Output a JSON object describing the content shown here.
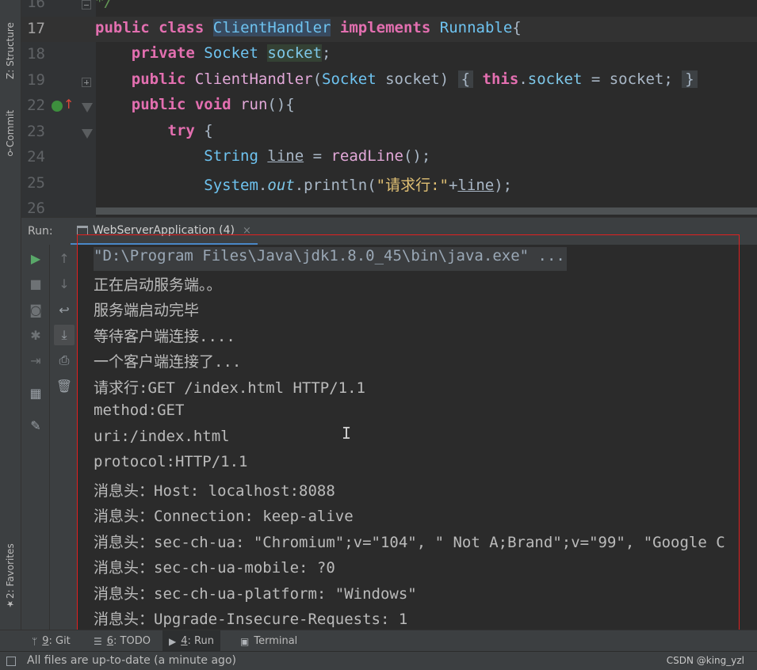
{
  "left_strip": {
    "structure_label": "Z: Structure",
    "commit_label": "Commit",
    "favorites_label": "2: Favorites"
  },
  "editor": {
    "lines": [
      {
        "num": "16",
        "tokens": [
          {
            "t": "*/",
            "c": "cm"
          }
        ],
        "indent": 0
      },
      {
        "num": "17",
        "current": true
      },
      {
        "num": "18"
      },
      {
        "num": "19"
      },
      {
        "num": "22"
      },
      {
        "num": "23"
      },
      {
        "num": "24"
      },
      {
        "num": "25"
      },
      {
        "num": "26"
      }
    ],
    "l17": {
      "kw1": "public",
      "kw2": "class",
      "cls": "ClientHandler",
      "kw3": "implements",
      "iface": "Runnable",
      "brace": "{"
    },
    "l18": {
      "kw": "private",
      "type": "Socket",
      "field": "socket",
      "semi": ";"
    },
    "l19": {
      "kw": "public",
      "ctor": "ClientHandler",
      "open": "(",
      "type": "Socket",
      "param": " socket)",
      "b1": "{",
      "this": "this",
      "dot": ".",
      "field": "socket",
      "rest": " = socket;",
      "b2": "}"
    },
    "l22": {
      "kw1": "public",
      "kw2": "void",
      "fn": "run",
      "rest": "(){"
    },
    "l23": {
      "kw": "try",
      "rest": " {"
    },
    "l24": {
      "type": "String",
      "var": "line",
      "eq": " = ",
      "fn": "readLine",
      "rest": "();"
    },
    "l25": {
      "cls": "System",
      "dot": ".",
      "out": "out",
      "call": ".println(",
      "str": "\"请求行:\"",
      "plus": "+",
      "var": "line",
      "rest": ");"
    }
  },
  "run_bar": {
    "label": "Run:",
    "tab_title": "WebServerApplication (4)",
    "tab_close": "×"
  },
  "console": {
    "lines": [
      "\"D:\\Program Files\\Java\\jdk1.8.0_45\\bin\\java.exe\" ...",
      "正在启动服务端。。",
      "服务端启动完毕",
      "等待客户端连接....",
      "一个客户端连接了...",
      "请求行:GET /index.html HTTP/1.1",
      "method:GET",
      "uri:/index.html",
      "protocol:HTTP/1.1",
      "消息头：Host: localhost:8088",
      "消息头：Connection: keep-alive",
      "消息头：sec-ch-ua: \"Chromium\";v=\"104\", \" Not A;Brand\";v=\"99\", \"Google C",
      "消息头：sec-ch-ua-mobile: ?0",
      "消息头：sec-ch-ua-platform: \"Windows\"",
      "消息头：Upgrade-Insecure-Requests: 1"
    ],
    "caret": "I"
  },
  "bottom_bar": {
    "git": {
      "num": "9",
      "label": ": Git"
    },
    "todo": {
      "num": "6",
      "label": ": TODO"
    },
    "run": {
      "num": "4",
      "label": ": Run"
    },
    "terminal": {
      "label": "Terminal"
    }
  },
  "status_bar": {
    "text": "All files are up-to-date (a minute ago)",
    "watermark": "CSDN @king_yzl"
  },
  "colors": {
    "editor_bg": "#2b2b2b",
    "panel_bg": "#3c3f41",
    "highlight_box": "#e02020",
    "keyword": "#e36fb0",
    "type": "#6ec3f0",
    "string": "#e0c074"
  }
}
